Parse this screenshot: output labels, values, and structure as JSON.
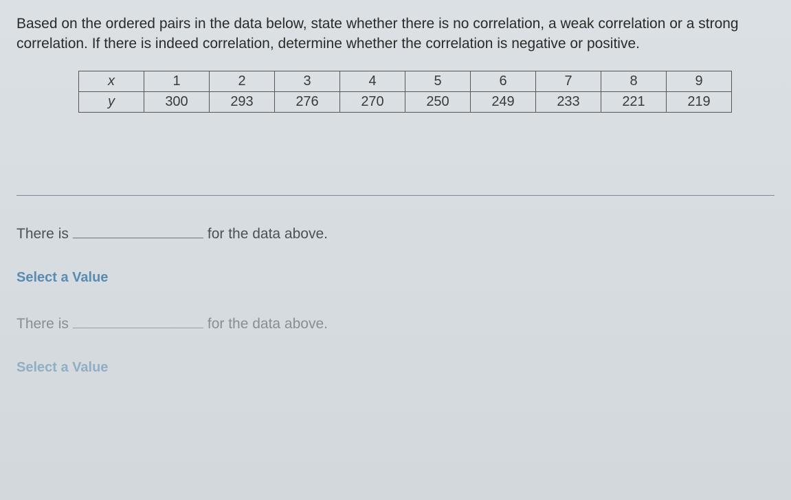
{
  "question": "Based on the ordered pairs in the data below, state whether there is no correlation, a weak correlation or a strong correlation. If there is indeed correlation, determine whether the correlation is negative or positive.",
  "table": {
    "x_label": "x",
    "y_label": "y",
    "x_values": [
      "1",
      "2",
      "3",
      "4",
      "5",
      "6",
      "7",
      "8",
      "9"
    ],
    "y_values": [
      "300",
      "293",
      "276",
      "270",
      "250",
      "249",
      "233",
      "221",
      "219"
    ]
  },
  "answer1": {
    "prefix": "There is",
    "suffix": "for the data above.",
    "select_label": "Select a Value"
  },
  "answer2": {
    "prefix": "There is",
    "suffix": "for the data above.",
    "select_label": "Select a Value"
  }
}
